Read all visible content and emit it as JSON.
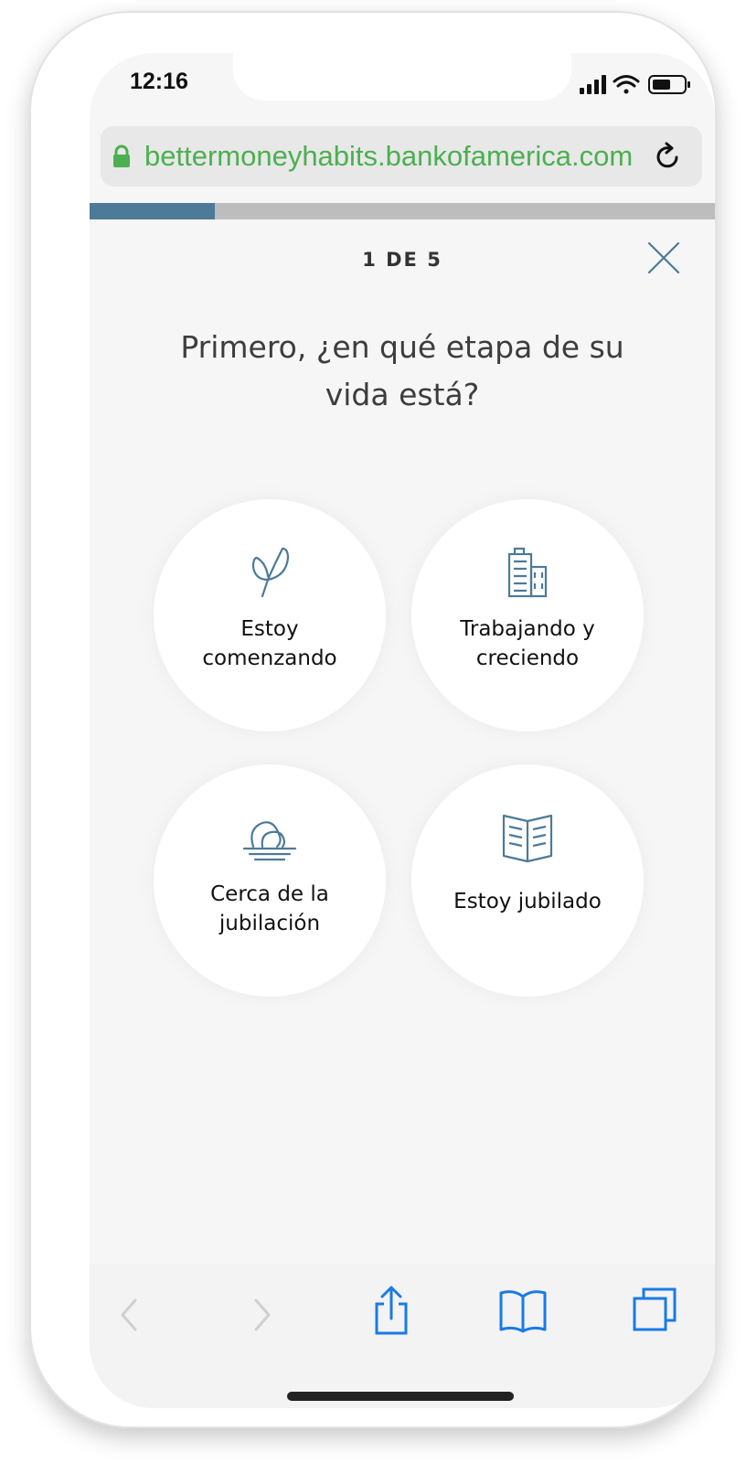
{
  "status_bar": {
    "time": "12:16",
    "icons": [
      "cellular-signal-icon",
      "wifi-icon",
      "battery-icon"
    ]
  },
  "browser": {
    "url": "bettermoneyhabits.bankofamerica.com",
    "secure": true,
    "icons": [
      "lock-icon",
      "reload-icon"
    ],
    "colors": {
      "url_text": "#4caf50",
      "accent_blue": "#1a7ae6"
    }
  },
  "quiz": {
    "progress": 0.2,
    "step": "1 DE 5",
    "question": "Primero, ¿en qué etapa de su vida está?",
    "close_icon": "close-icon",
    "colors": {
      "progress_fill": "#4d7a98",
      "progress_track": "#bdbdbd",
      "icon_stroke": "#4d7a98"
    },
    "options": [
      {
        "label": "Estoy comenzando",
        "icon": "sprout-icon"
      },
      {
        "label": "Trabajando y creciendo",
        "icon": "office-building-icon"
      },
      {
        "label": "Cerca de la jubilación",
        "icon": "nest-egg-icon"
      },
      {
        "label": "Estoy jubilado",
        "icon": "open-book-icon"
      }
    ]
  },
  "toolbar": {
    "icons": [
      "back-arrow-icon",
      "forward-arrow-icon",
      "share-icon",
      "bookmarks-icon",
      "tabs-icon"
    ]
  }
}
